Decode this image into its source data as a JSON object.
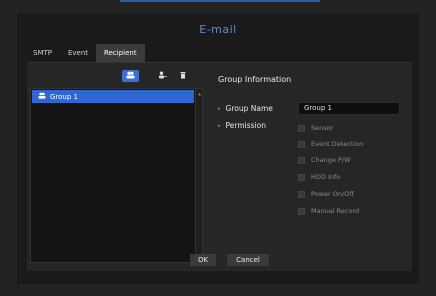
{
  "window": {
    "title": "E-mail"
  },
  "tabs": [
    {
      "label": "SMTP"
    },
    {
      "label": "Event"
    },
    {
      "label": "Recipient"
    }
  ],
  "toolbar": {
    "icons": [
      "add-group-icon",
      "add-user-icon",
      "delete-icon"
    ]
  },
  "tree": {
    "items": [
      {
        "label": "Group 1",
        "icon": "group-icon"
      }
    ]
  },
  "info": {
    "title": "Group Information",
    "group_name_label": "Group Name",
    "group_name_value": "Group 1",
    "permission_label": "Permission",
    "permissions": [
      {
        "label": "Sensor"
      },
      {
        "label": "Event Detection"
      },
      {
        "label": "Change P/W"
      },
      {
        "label": "HDD Info"
      },
      {
        "label": "Power On/Off"
      },
      {
        "label": "Manual Record"
      }
    ]
  },
  "buttons": {
    "ok": "OK",
    "cancel": "Cancel"
  },
  "colors": {
    "accent": "#2f66d1",
    "title": "#5f8ad8",
    "background": "#1a1a1a"
  }
}
